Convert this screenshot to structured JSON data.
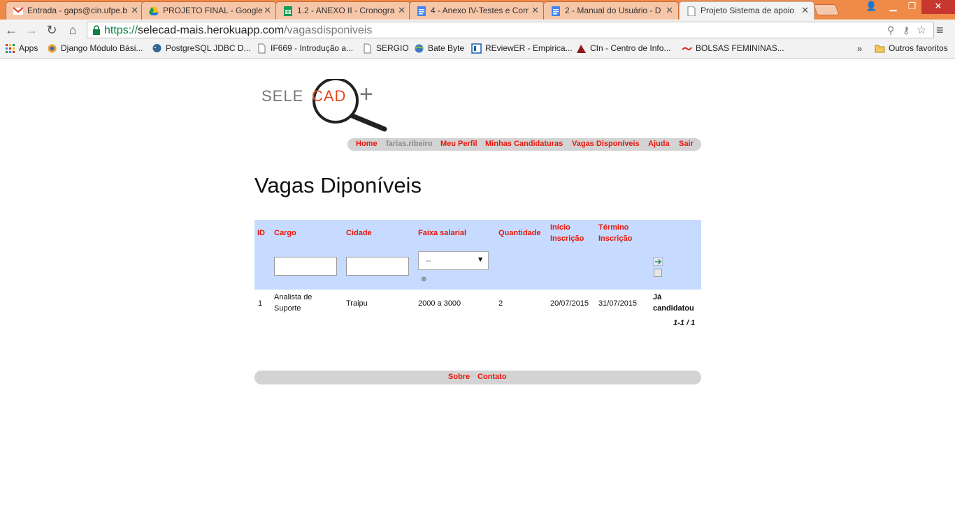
{
  "browser": {
    "tabs": [
      {
        "title": "Entrada - gaps@cin.ufpe.b",
        "favicon": "gmail-icon"
      },
      {
        "title": "PROJETO FINAL - Google",
        "favicon": "google-drive-icon"
      },
      {
        "title": "1.2 - ANEXO II - Cronogra",
        "favicon": "google-sheets-icon"
      },
      {
        "title": "4 - Anexo IV-Testes e Corr",
        "favicon": "google-docs-icon"
      },
      {
        "title": "2 - Manual do Usuário - D",
        "favicon": "google-docs-icon"
      },
      {
        "title": "Projeto Sistema de apoio",
        "favicon": "page-icon",
        "active": true
      }
    ],
    "url": {
      "scheme": "https://",
      "host": "selecad-mais.herokuapp.com",
      "path": "/vagasdisponiveis"
    },
    "bookmarks": [
      {
        "label": "Apps",
        "icon": "apps-grid-icon"
      },
      {
        "label": "Django Módulo Bási...",
        "icon": "django-icon"
      },
      {
        "label": "PostgreSQL JDBC D...",
        "icon": "postgresql-icon"
      },
      {
        "label": "IF669 - Introdução a...",
        "icon": "page-icon"
      },
      {
        "label": "SERGIO",
        "icon": "page-icon"
      },
      {
        "label": "Bate Byte",
        "icon": "globe-icon"
      },
      {
        "label": "REviewER - Empirica...",
        "icon": "reviewer-icon"
      },
      {
        "label": "CIn - Centro de Info...",
        "icon": "cin-icon"
      },
      {
        "label": "BOLSAS FEMININAS...",
        "icon": "bolsas-icon"
      }
    ],
    "bookmarks_more": "»",
    "other_bookmarks": "Outros favoritos"
  },
  "site": {
    "logo": {
      "left": "SELE",
      "middle": "CAD",
      "right": "+"
    },
    "nav": {
      "home": "Home",
      "user": "farias.ribeiro",
      "profile": "Meu Perfil",
      "applications": "Minhas Candidaturas",
      "vacancies": "Vagas Disponíveis",
      "help": "Ajuda",
      "logout": "Sair"
    },
    "title": "Vagas Diponíveis",
    "table": {
      "headers": {
        "id": "ID",
        "cargo": "Cargo",
        "cidade": "Cidade",
        "faixa": "Faixa salarial",
        "quantidade": "Quantidade",
        "inicio": "Início Inscrição",
        "termino": "Término Inscrição"
      },
      "salary_filter_value": "--",
      "rows": [
        {
          "id": "1",
          "cargo": "Analista de Suporte",
          "cidade": "Traipu",
          "faixa": "2000 a 3000",
          "quantidade": "2",
          "inicio": "20/07/2015",
          "termino": "31/07/2015",
          "status": "Já candidatou"
        }
      ],
      "pager": "1-1 / 1"
    },
    "footer": {
      "about": "Sobre",
      "contact": "Contato"
    }
  }
}
